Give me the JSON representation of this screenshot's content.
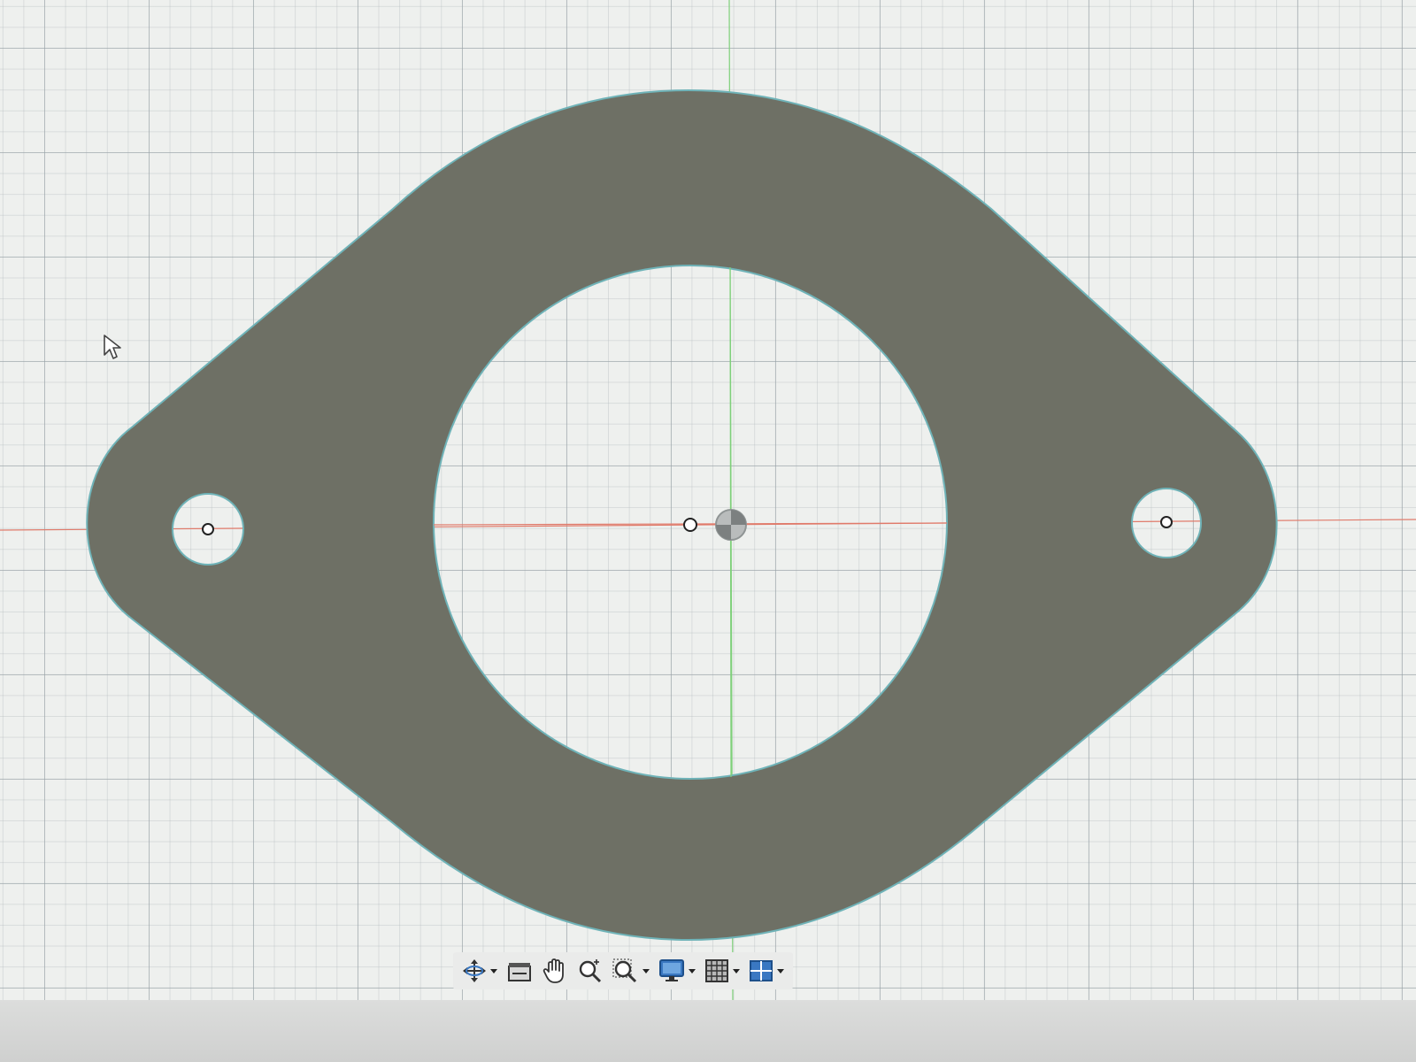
{
  "app": {
    "view": "sketch-canvas"
  },
  "colors": {
    "grid_background": "#eef0ee",
    "grid_major": "#9aa3a8",
    "grid_minor": "#b4babd",
    "x_axis": "#e07a6a",
    "y_axis": "#7fd07a",
    "profile_fill": "#6e7065",
    "profile_edge": "#6fb3b8",
    "cutout_fill": "#e6eeee"
  },
  "toolbar": {
    "items": [
      {
        "id": "orbit",
        "icon": "orbit-icon",
        "has_dropdown": true
      },
      {
        "id": "look-at",
        "icon": "look-at-icon",
        "has_dropdown": false
      },
      {
        "id": "pan",
        "icon": "pan-hand-icon",
        "has_dropdown": false
      },
      {
        "id": "zoom",
        "icon": "zoom-icon",
        "has_dropdown": false
      },
      {
        "id": "fit",
        "icon": "zoom-window-icon",
        "has_dropdown": true
      },
      {
        "id": "display-settings",
        "icon": "display-settings-icon",
        "has_dropdown": true
      },
      {
        "id": "grid-snaps",
        "icon": "grid-icon",
        "has_dropdown": true
      },
      {
        "id": "viewports",
        "icon": "viewports-icon",
        "has_dropdown": true
      }
    ]
  }
}
